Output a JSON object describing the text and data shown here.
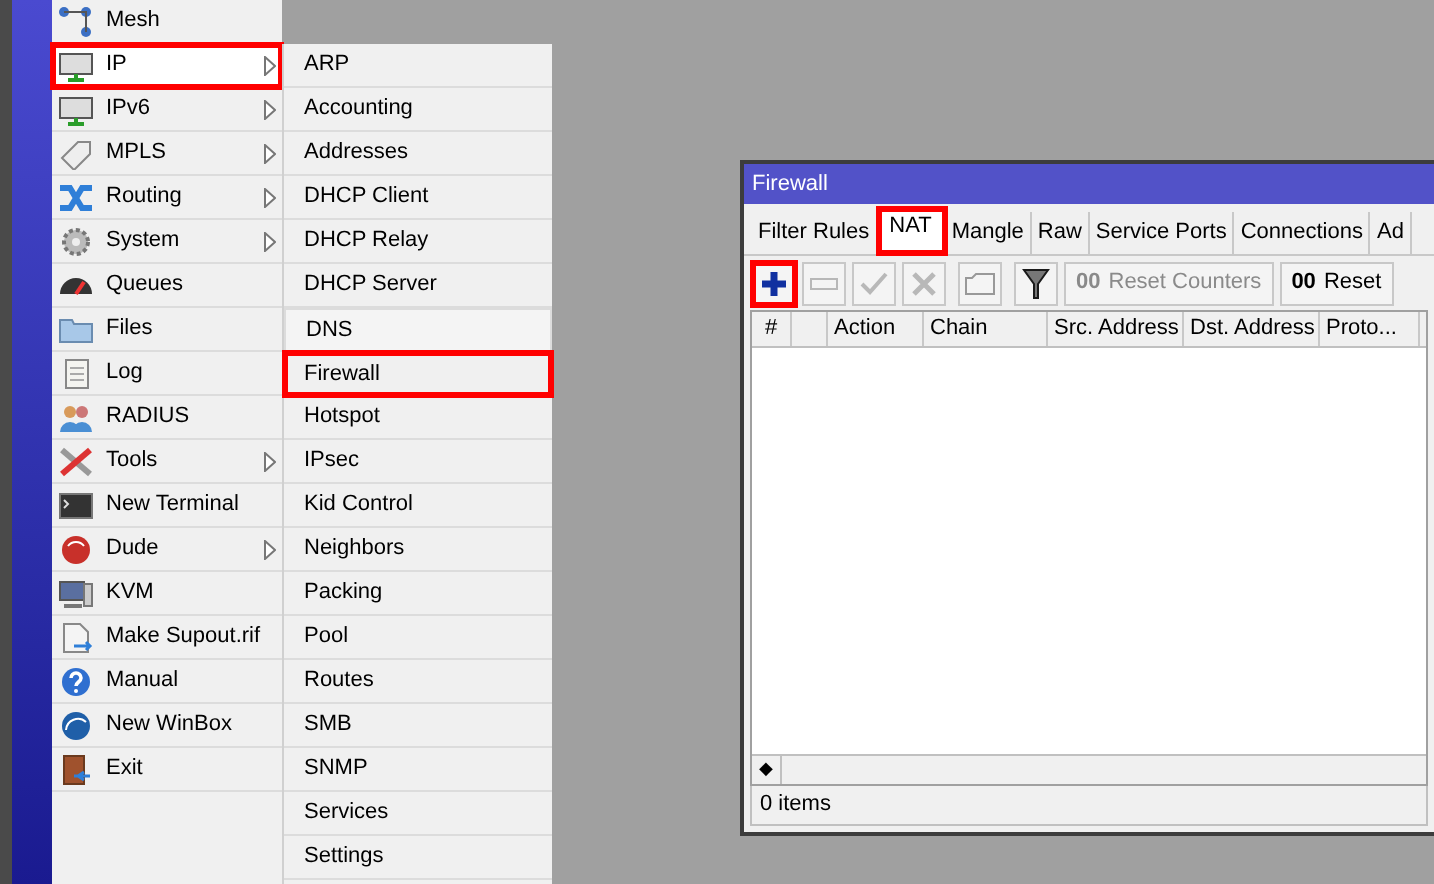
{
  "menu": {
    "items": [
      {
        "label": "Mesh",
        "submenu": false,
        "highlighted": false
      },
      {
        "label": "IP",
        "submenu": true,
        "highlighted": true
      },
      {
        "label": "IPv6",
        "submenu": true,
        "highlighted": false
      },
      {
        "label": "MPLS",
        "submenu": true,
        "highlighted": false
      },
      {
        "label": "Routing",
        "submenu": true,
        "highlighted": false
      },
      {
        "label": "System",
        "submenu": true,
        "highlighted": false
      },
      {
        "label": "Queues",
        "submenu": false,
        "highlighted": false
      },
      {
        "label": "Files",
        "submenu": false,
        "highlighted": false
      },
      {
        "label": "Log",
        "submenu": false,
        "highlighted": false
      },
      {
        "label": "RADIUS",
        "submenu": false,
        "highlighted": false
      },
      {
        "label": "Tools",
        "submenu": true,
        "highlighted": false
      },
      {
        "label": "New Terminal",
        "submenu": false,
        "highlighted": false
      },
      {
        "label": "Dude",
        "submenu": true,
        "highlighted": false
      },
      {
        "label": "KVM",
        "submenu": false,
        "highlighted": false
      },
      {
        "label": "Make Supout.rif",
        "submenu": false,
        "highlighted": false
      },
      {
        "label": "Manual",
        "submenu": false,
        "highlighted": false
      },
      {
        "label": "New WinBox",
        "submenu": false,
        "highlighted": false
      },
      {
        "label": "Exit",
        "submenu": false,
        "highlighted": false
      }
    ]
  },
  "submenu": {
    "items": [
      {
        "label": "ARP",
        "highlighted": false,
        "hovered": false
      },
      {
        "label": "Accounting",
        "highlighted": false,
        "hovered": false
      },
      {
        "label": "Addresses",
        "highlighted": false,
        "hovered": false
      },
      {
        "label": "DHCP Client",
        "highlighted": false,
        "hovered": false
      },
      {
        "label": "DHCP Relay",
        "highlighted": false,
        "hovered": false
      },
      {
        "label": "DHCP Server",
        "highlighted": false,
        "hovered": false
      },
      {
        "label": "DNS",
        "highlighted": false,
        "hovered": true
      },
      {
        "label": "Firewall",
        "highlighted": true,
        "hovered": false
      },
      {
        "label": "Hotspot",
        "highlighted": false,
        "hovered": false
      },
      {
        "label": "IPsec",
        "highlighted": false,
        "hovered": false
      },
      {
        "label": "Kid Control",
        "highlighted": false,
        "hovered": false
      },
      {
        "label": "Neighbors",
        "highlighted": false,
        "hovered": false
      },
      {
        "label": "Packing",
        "highlighted": false,
        "hovered": false
      },
      {
        "label": "Pool",
        "highlighted": false,
        "hovered": false
      },
      {
        "label": "Routes",
        "highlighted": false,
        "hovered": false
      },
      {
        "label": "SMB",
        "highlighted": false,
        "hovered": false
      },
      {
        "label": "SNMP",
        "highlighted": false,
        "hovered": false
      },
      {
        "label": "Services",
        "highlighted": false,
        "hovered": false
      },
      {
        "label": "Settings",
        "highlighted": false,
        "hovered": false
      }
    ]
  },
  "window": {
    "title": "Firewall",
    "tabs": [
      {
        "label": "Filter Rules",
        "selected": false,
        "highlighted": false
      },
      {
        "label": "NAT",
        "selected": true,
        "highlighted": true
      },
      {
        "label": "Mangle",
        "selected": false,
        "highlighted": false
      },
      {
        "label": "Raw",
        "selected": false,
        "highlighted": false
      },
      {
        "label": "Service Ports",
        "selected": false,
        "highlighted": false
      },
      {
        "label": "Connections",
        "selected": false,
        "highlighted": false
      },
      {
        "label": "Ad",
        "selected": false,
        "highlighted": false
      }
    ],
    "toolbar": [
      {
        "kind": "add",
        "disabled": false,
        "highlighted": true
      },
      {
        "kind": "remove",
        "disabled": true,
        "highlighted": false
      },
      {
        "kind": "enable",
        "disabled": true,
        "highlighted": false
      },
      {
        "kind": "disable",
        "disabled": true,
        "highlighted": false
      },
      {
        "kind": "comment",
        "disabled": true,
        "highlighted": false
      },
      {
        "kind": "filter",
        "disabled": false,
        "highlighted": false
      },
      {
        "kind": "text",
        "icon_text": "00",
        "label": "Reset Counters",
        "disabled": true,
        "highlighted": false
      },
      {
        "kind": "text",
        "icon_text": "00",
        "label": "Reset",
        "disabled": false,
        "highlighted": false
      }
    ],
    "columns": [
      {
        "kind": "label",
        "label": "#"
      },
      {
        "kind": "spacer"
      },
      {
        "kind": "label",
        "label": "Action"
      },
      {
        "kind": "label",
        "label": "Chain"
      },
      {
        "kind": "label",
        "label": "Src. Address"
      },
      {
        "kind": "label",
        "label": "Dst. Address"
      },
      {
        "kind": "label",
        "label": "Proto..."
      }
    ],
    "scroll_arrow": "◆",
    "status": "0 items"
  }
}
